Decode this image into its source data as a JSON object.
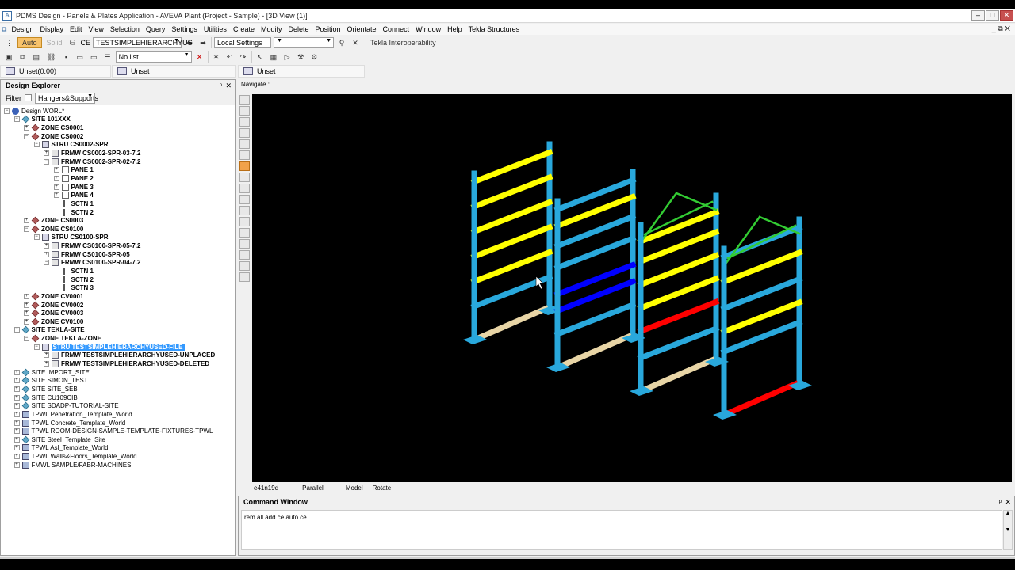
{
  "window": {
    "title": "PDMS Design - Panels & Plates Application - AVEVA Plant (Project - Sample) - [3D View (1)]",
    "min": "–",
    "max": "□",
    "close": "✕"
  },
  "menu": {
    "items": [
      "Design",
      "Display",
      "Edit",
      "View",
      "Selection",
      "Query",
      "Settings",
      "Utilities",
      "Create",
      "Modify",
      "Delete",
      "Position",
      "Orientate",
      "Connect",
      "Window",
      "Help",
      "Tekla Structures"
    ],
    "restore": "_ ⧉ ✕"
  },
  "toolbar1": {
    "auto": "Auto",
    "solid": "Solid",
    "ce_label": "CE",
    "ce_value": "TESTSIMPLEHIERARCHYUS",
    "settings_value": "Local Settings",
    "tekla_button": "Tekla Interoperability"
  },
  "toolbar2": {
    "list_value": "No list"
  },
  "docbar": {
    "left_tab": "Unset(0.00)",
    "middle_tab": "Unset",
    "right_tab": "Unset"
  },
  "explorer": {
    "title": "Design Explorer",
    "pin": "ᵖ",
    "close": "✕",
    "filter_label": "Filter",
    "filter_value": "Hangers&Supports",
    "nodes": [
      {
        "text": "Design WORL*",
        "depth": 0,
        "exp": "-",
        "icon": "world",
        "bold": false
      },
      {
        "text": "SITE 101XXX",
        "depth": 1,
        "exp": "-",
        "icon": "site",
        "bold": true
      },
      {
        "text": "ZONE CS0001",
        "depth": 2,
        "exp": "+",
        "icon": "zone",
        "bold": true
      },
      {
        "text": "ZONE CS0002",
        "depth": 2,
        "exp": "-",
        "icon": "zone",
        "bold": true
      },
      {
        "text": "STRU CS0002-SPR",
        "depth": 3,
        "exp": "-",
        "icon": "stru",
        "bold": true
      },
      {
        "text": "FRMW CS0002-SPR-03-7.2",
        "depth": 4,
        "exp": "+",
        "icon": "frmw",
        "bold": true
      },
      {
        "text": "FRMW CS0002-SPR-02-7.2",
        "depth": 4,
        "exp": "-",
        "icon": "frmw",
        "bold": true
      },
      {
        "text": "PANE 1",
        "depth": 5,
        "exp": "+",
        "icon": "pane",
        "bold": true
      },
      {
        "text": "PANE 2",
        "depth": 5,
        "exp": "+",
        "icon": "pane",
        "bold": true
      },
      {
        "text": "PANE 3",
        "depth": 5,
        "exp": "+",
        "icon": "pane",
        "bold": true
      },
      {
        "text": "PANE 4",
        "depth": 5,
        "exp": "+",
        "icon": "pane",
        "bold": true
      },
      {
        "text": "SCTN 1",
        "depth": 5,
        "exp": "",
        "icon": "sctn",
        "bold": true
      },
      {
        "text": "SCTN 2",
        "depth": 5,
        "exp": "",
        "icon": "sctn",
        "bold": true
      },
      {
        "text": "ZONE CS0003",
        "depth": 2,
        "exp": "+",
        "icon": "zone",
        "bold": true
      },
      {
        "text": "ZONE CS0100",
        "depth": 2,
        "exp": "-",
        "icon": "zone",
        "bold": true
      },
      {
        "text": "STRU CS0100-SPR",
        "depth": 3,
        "exp": "-",
        "icon": "stru",
        "bold": true
      },
      {
        "text": "FRMW CS0100-SPR-05-7.2",
        "depth": 4,
        "exp": "+",
        "icon": "frmw",
        "bold": true
      },
      {
        "text": "FRMW CS0100-SPR-05",
        "depth": 4,
        "exp": "+",
        "icon": "frmw",
        "bold": true
      },
      {
        "text": "FRMW CS0100-SPR-04-7.2",
        "depth": 4,
        "exp": "-",
        "icon": "frmw",
        "bold": true
      },
      {
        "text": "SCTN 1",
        "depth": 5,
        "exp": "",
        "icon": "sctn",
        "bold": true
      },
      {
        "text": "SCTN 2",
        "depth": 5,
        "exp": "",
        "icon": "sctn",
        "bold": true
      },
      {
        "text": "SCTN 3",
        "depth": 5,
        "exp": "",
        "icon": "sctn",
        "bold": true
      },
      {
        "text": "ZONE CV0001",
        "depth": 2,
        "exp": "+",
        "icon": "zone",
        "bold": true
      },
      {
        "text": "ZONE CV0002",
        "depth": 2,
        "exp": "+",
        "icon": "zone",
        "bold": true
      },
      {
        "text": "ZONE CV0003",
        "depth": 2,
        "exp": "+",
        "icon": "zone",
        "bold": true
      },
      {
        "text": "ZONE CV0100",
        "depth": 2,
        "exp": "+",
        "icon": "zone",
        "bold": true
      },
      {
        "text": "SITE TEKLA-SITE",
        "depth": 1,
        "exp": "-",
        "icon": "site",
        "bold": true
      },
      {
        "text": "ZONE TEKLA-ZONE",
        "depth": 2,
        "exp": "-",
        "icon": "zone",
        "bold": true
      },
      {
        "text": "STRU TESTSIMPLEHIERARCHYUSED-FILE",
        "depth": 3,
        "exp": "-",
        "icon": "stru",
        "bold": true,
        "selected": true
      },
      {
        "text": "FRMW TESTSIMPLEHIERARCHYUSED-UNPLACED",
        "depth": 4,
        "exp": "+",
        "icon": "frmw",
        "bold": true
      },
      {
        "text": "FRMW TESTSIMPLEHIERARCHYUSED-DELETED",
        "depth": 4,
        "exp": "+",
        "icon": "frmw",
        "bold": true
      },
      {
        "text": "SITE IMPORT_SITE",
        "depth": 1,
        "exp": "+",
        "icon": "site",
        "bold": false
      },
      {
        "text": "SITE SIMON_TEST",
        "depth": 1,
        "exp": "+",
        "icon": "site",
        "bold": false
      },
      {
        "text": "SITE SITE_SEB",
        "depth": 1,
        "exp": "+",
        "icon": "site",
        "bold": false
      },
      {
        "text": "SITE CU109CIB",
        "depth": 1,
        "exp": "+",
        "icon": "site",
        "bold": false
      },
      {
        "text": "SITE SDADP-TUTORIAL-SITE",
        "depth": 1,
        "exp": "+",
        "icon": "site",
        "bold": false
      },
      {
        "text": "TPWL Penetration_Template_World",
        "depth": 1,
        "exp": "+",
        "icon": "tpwl",
        "bold": false
      },
      {
        "text": "TPWL Concrete_Template_World",
        "depth": 1,
        "exp": "+",
        "icon": "tpwl",
        "bold": false
      },
      {
        "text": "TPWL ROOM-DESIGN-SAMPLE-TEMPLATE-FIXTURES-TPWL",
        "depth": 1,
        "exp": "+",
        "icon": "tpwl",
        "bold": false
      },
      {
        "text": "SITE Steel_Template_Site",
        "depth": 1,
        "exp": "+",
        "icon": "site",
        "bold": false
      },
      {
        "text": "TPWL Asl_Template_World",
        "depth": 1,
        "exp": "+",
        "icon": "tpwl",
        "bold": false
      },
      {
        "text": "TPWL Walls&Floors_Template_World",
        "depth": 1,
        "exp": "+",
        "icon": "tpwl",
        "bold": false
      },
      {
        "text": "FMWL SAMPLE/FABR-MACHINES",
        "depth": 1,
        "exp": "+",
        "icon": "tpwl",
        "bold": false
      }
    ]
  },
  "view3d": {
    "navigate_label": "Navigate :",
    "status": {
      "direction": "e41n19d",
      "projection": "Parallel",
      "mode": "Model",
      "action": "Rotate"
    },
    "colors": {
      "column": "#29a8dc",
      "yellow": "#ffff00",
      "blue": "#0000ff",
      "red": "#ff0000",
      "green": "#33cc33",
      "tan": "#e8d5a6"
    }
  },
  "command": {
    "title": "Command Window",
    "pin": "ᵖ",
    "close": "✕",
    "text": "rem all add ce auto ce"
  }
}
